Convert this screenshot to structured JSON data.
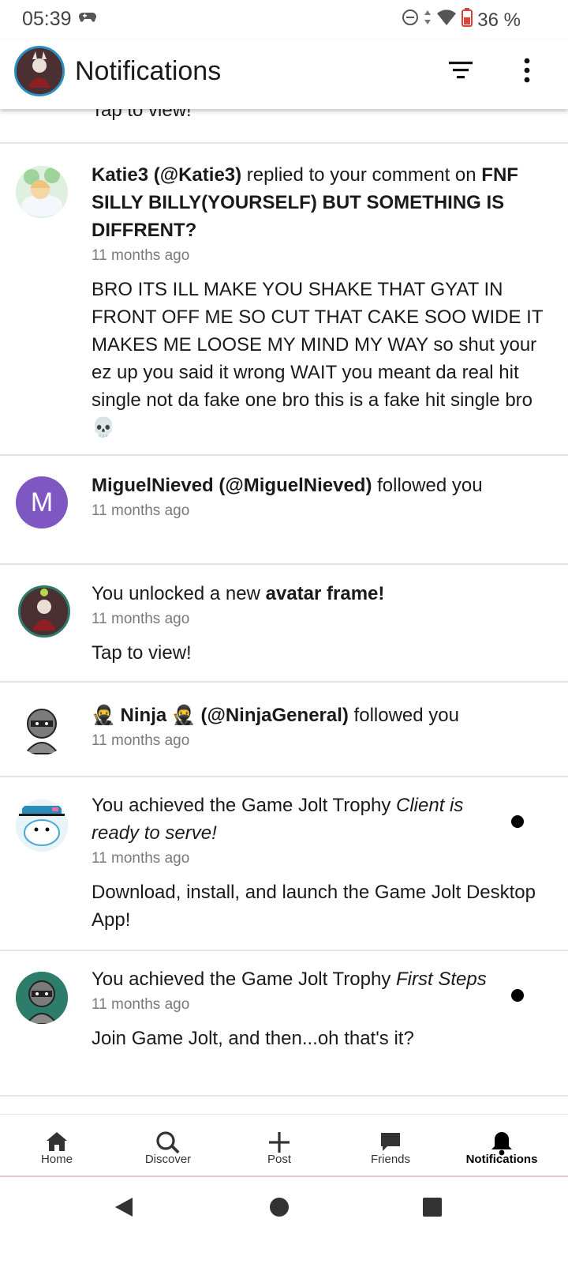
{
  "status_bar": {
    "time": "05:39",
    "battery": "36 %"
  },
  "app_bar": {
    "title": "Notifications"
  },
  "feed": {
    "partial_text": "Tap to view!",
    "notifications": [
      {
        "user": "Katie3 (@Katie3)",
        "action": " replied to your comment on ",
        "target": "FNF SILLY BILLY(YOURSELF) BUT SOMETHING IS DIFFRENT?",
        "time": "11 months ago",
        "message": "BRO ITS ILL MAKE YOU SHAKE THAT GYAT IN FRONT OFF ME SO CUT THAT CAKE SOO WIDE IT MAKES ME LOOSE MY MIND MY WAY so shut your ez up you said it wrong WAIT you meant da real hit single not da fake one bro this is a fake hit single bro💀"
      },
      {
        "avatar_letter": "M",
        "user": "MiguelNieved (@MiguelNieved)",
        "action": " followed you",
        "time": "11 months ago"
      },
      {
        "prefix": "You unlocked a new ",
        "target": "avatar frame!",
        "time": "11 months ago",
        "message": "Tap to view!"
      },
      {
        "user": "🥷 Ninja 🥷 (@NinjaGeneral)",
        "action": " followed you",
        "time": "11 months ago"
      },
      {
        "prefix": "You achieved the Game Jolt Trophy ",
        "trophy": "Client is ready to serve!",
        "time": "11 months ago",
        "message": "Download, install, and launch the Game Jolt Desktop App!"
      },
      {
        "prefix": "You achieved the Game Jolt Trophy ",
        "trophy": "First Steps",
        "time": "11 months ago",
        "message": "Join Game Jolt, and then...oh that's it?"
      }
    ]
  },
  "bottom_nav": {
    "items": [
      {
        "label": "Home",
        "icon": "home-icon"
      },
      {
        "label": "Discover",
        "icon": "search-icon"
      },
      {
        "label": "Post",
        "icon": "plus-icon"
      },
      {
        "label": "Friends",
        "icon": "chat-icon"
      },
      {
        "label": "Notifications",
        "icon": "bell-icon",
        "active": true
      }
    ]
  },
  "colors": {
    "accent_avatar_purple": "#7e57c2",
    "avatar_ring_blue": "#2a8fbf",
    "avatar_ring_teal": "#2e7d6b"
  }
}
